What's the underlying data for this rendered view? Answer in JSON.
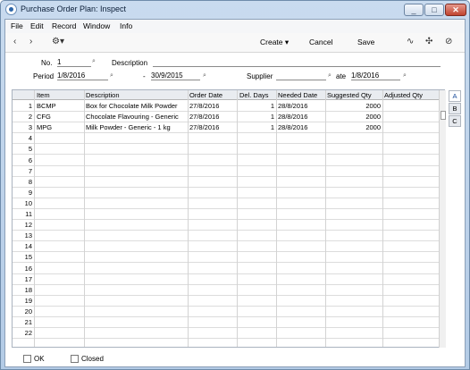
{
  "window": {
    "title": "Purchase Order Plan: Inspect",
    "minimize": "_",
    "maximize": "□",
    "close": "✕"
  },
  "menu": [
    "File",
    "Edit",
    "Record",
    "Window",
    "Info"
  ],
  "toolbar": {
    "back": "‹",
    "forward": "›",
    "gear": "⚙▾",
    "create": "Create ▾",
    "cancel": "Cancel",
    "save": "Save",
    "tool1": "∿",
    "tool2": "✣",
    "tool3": "⊘"
  },
  "form": {
    "no_label": "No.",
    "no_value": "1",
    "description_label": "Description",
    "description_value": "",
    "period_label": "Period",
    "period_from": "1/8/2016",
    "period_sep": "-",
    "period_to": "30/9/2015",
    "supplier_label": "Supplier",
    "supplier_value": "",
    "date_label": "ate",
    "date_value": "1/8/2016",
    "paste_symbol": "⌕"
  },
  "grid": {
    "headers": [
      "Item",
      "Description",
      "Order Date",
      "Del. Days",
      "Needed Date",
      "Suggested Qty",
      "Adjusted Qty"
    ],
    "rows": [
      {
        "n": "1",
        "item": "BCMP",
        "desc": "Box for Chocolate Milk Powder",
        "order": "27/8/2016",
        "days": "1",
        "needed": "28/8/2016",
        "sugg": "2000",
        "adj": ""
      },
      {
        "n": "2",
        "item": "CFG",
        "desc": "Chocolate Flavouring - Generic",
        "order": "27/8/2016",
        "days": "1",
        "needed": "28/8/2016",
        "sugg": "2000",
        "adj": ""
      },
      {
        "n": "3",
        "item": "MPG",
        "desc": "Milk Powder - Generic - 1 kg",
        "order": "27/8/2016",
        "days": "1",
        "needed": "28/8/2016",
        "sugg": "2000",
        "adj": ""
      },
      {
        "n": "4"
      },
      {
        "n": "5"
      },
      {
        "n": "6"
      },
      {
        "n": "7"
      },
      {
        "n": "8"
      },
      {
        "n": "9"
      },
      {
        "n": "10"
      },
      {
        "n": "11"
      },
      {
        "n": "12"
      },
      {
        "n": "13"
      },
      {
        "n": "14"
      },
      {
        "n": "15"
      },
      {
        "n": "16"
      },
      {
        "n": "17"
      },
      {
        "n": "18"
      },
      {
        "n": "19"
      },
      {
        "n": "20"
      },
      {
        "n": "21"
      },
      {
        "n": "22"
      }
    ]
  },
  "tabs": [
    "A",
    "B",
    "C"
  ],
  "footer": {
    "ok_label": "OK",
    "closed_label": "Closed"
  }
}
